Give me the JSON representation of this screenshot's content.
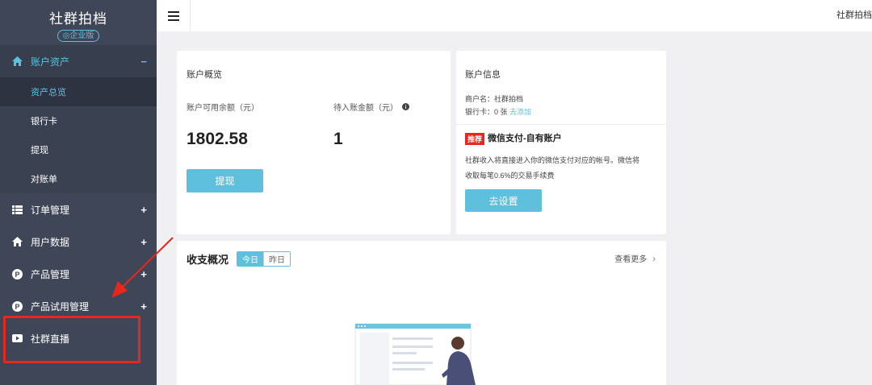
{
  "brand": {
    "name": "社群拍档",
    "badge": "企业版"
  },
  "sidebar": {
    "groups": [
      {
        "label": "账户资产",
        "toggle": "−"
      },
      {
        "label": "订单管理",
        "toggle": "+"
      },
      {
        "label": "用户数据",
        "toggle": "+"
      },
      {
        "label": "产品管理",
        "toggle": "+"
      },
      {
        "label": "产品试用管理",
        "toggle": "+"
      },
      {
        "label": "社群直播"
      }
    ],
    "sub_items": [
      "资产总览",
      "银行卡",
      "提现",
      "对账单"
    ]
  },
  "topbar": {
    "user": "社群拍档"
  },
  "account_overview": {
    "title": "账户概览",
    "available_label": "账户可用余额（元）",
    "available_value": "1802.58",
    "pending_label": "待入账金额（元）",
    "pending_value": "1",
    "withdraw_button": "提现"
  },
  "account_info": {
    "title": "账户信息",
    "merchant_label": "商户名：",
    "merchant_value": "社群拍档",
    "bank_label": "银行卡：",
    "bank_value": "0 张",
    "bank_link": "去添加",
    "tag": "推荐",
    "wechat_title": "微信支付-自有账户",
    "wechat_desc_1": "社群收入将直接进入你的微信支付对应的帐号。微信将",
    "wechat_desc_2": "收取每笔0.6%的交易手续费",
    "setup_button": "去设置"
  },
  "income": {
    "title": "收支概况",
    "tab_today": "今日",
    "tab_yesterday": "昨日",
    "more": "查看更多",
    "more_arrow": "›"
  },
  "colors": {
    "accent": "#5fc0de",
    "sidebar": "#3f4657",
    "annotation": "#e8261c"
  }
}
